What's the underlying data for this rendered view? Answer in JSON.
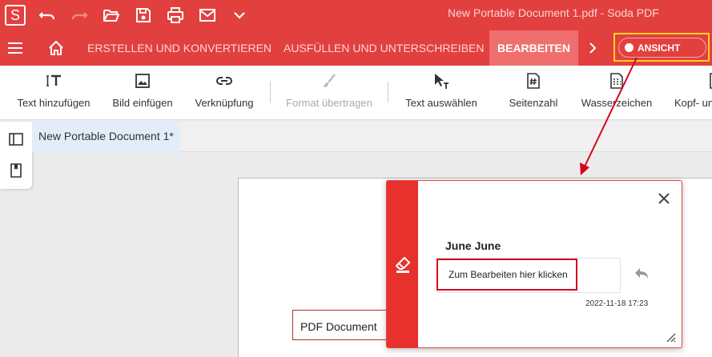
{
  "app": {
    "logo_letter": "S",
    "window_title": "New Portable Document 1.pdf  -  Soda PDF"
  },
  "quick_access": [
    {
      "name": "undo-icon"
    },
    {
      "name": "redo-icon"
    },
    {
      "name": "open-folder-icon"
    },
    {
      "name": "save-icon"
    },
    {
      "name": "print-icon"
    },
    {
      "name": "mail-icon"
    },
    {
      "name": "chevron-down-icon"
    }
  ],
  "ribbon": {
    "tabs": [
      {
        "label": "ERSTELLEN UND KONVERTIEREN",
        "active": false
      },
      {
        "label": "AUSFÜLLEN UND UNTERSCHREIBEN",
        "active": false
      },
      {
        "label": "BEARBEITEN",
        "active": true
      }
    ],
    "view_toggle_label": "ANSICHT"
  },
  "toolbar": {
    "tools": [
      {
        "label": "Text hinzufügen",
        "icon": "text-add-icon",
        "enabled": true
      },
      {
        "label": "Bild einfügen",
        "icon": "image-icon",
        "enabled": true
      },
      {
        "label": "Verknüpfung",
        "icon": "link-icon",
        "enabled": true
      },
      {
        "label": "Format übertragen",
        "icon": "brush-icon",
        "enabled": false
      },
      {
        "label": "Text auswählen",
        "icon": "text-select-icon",
        "enabled": true
      },
      {
        "label": "Seitenzahl",
        "icon": "page-number-icon",
        "enabled": true
      },
      {
        "label": "Wasserzeichen",
        "icon": "watermark-icon",
        "enabled": true
      },
      {
        "label": "Kopf- un",
        "icon": "header-footer-icon",
        "enabled": true
      }
    ]
  },
  "document": {
    "tab_title": "New Portable Document 1*",
    "text_field_value": "PDF Document"
  },
  "comment_popup": {
    "author": "June June",
    "comment_text": "Zum Bearbeiten hier klicken",
    "timestamp": "2022-11-18 17:23"
  },
  "colors": {
    "brand_red": "#e2403f",
    "active_tab": "#ef6f6e",
    "highlight_yellow": "#ffd21f",
    "annotation_red": "#d4061c"
  }
}
